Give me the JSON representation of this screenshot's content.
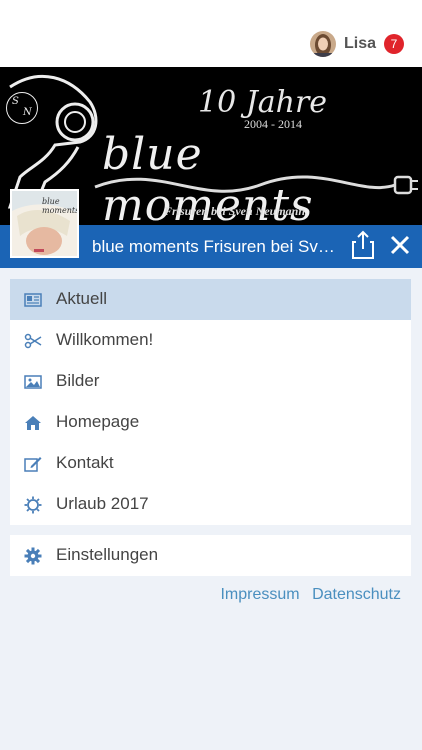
{
  "user": {
    "name": "Lisa",
    "notifications": "7"
  },
  "banner": {
    "headline": "10 Jahre",
    "years": "2004 - 2014",
    "brand": "blue moments",
    "subtitle": "Frisuren bei Sven Neumann",
    "monogram_s": "S",
    "monogram_n": "N"
  },
  "thumb": {
    "brand": "blue moments"
  },
  "pagebar": {
    "title": "blue moments Frisuren bei Sven Neumann"
  },
  "menu": {
    "items": [
      {
        "label": "Aktuell",
        "icon": "newspaper-icon"
      },
      {
        "label": "Willkommen!",
        "icon": "scissors-icon"
      },
      {
        "label": "Bilder",
        "icon": "image-icon"
      },
      {
        "label": "Homepage",
        "icon": "home-icon"
      },
      {
        "label": "Kontakt",
        "icon": "edit-icon"
      },
      {
        "label": "Urlaub 2017",
        "icon": "sun-icon"
      }
    ],
    "settings": {
      "label": "Einstellungen",
      "icon": "gear-icon"
    }
  },
  "footer": {
    "impressum": "Impressum",
    "datenschutz": "Datenschutz"
  },
  "colors": {
    "accent": "#1b64b5",
    "active_item": "#c9daec",
    "badge": "#e0242b",
    "link": "#4a8fbf",
    "icon": "#4a7fb8"
  }
}
